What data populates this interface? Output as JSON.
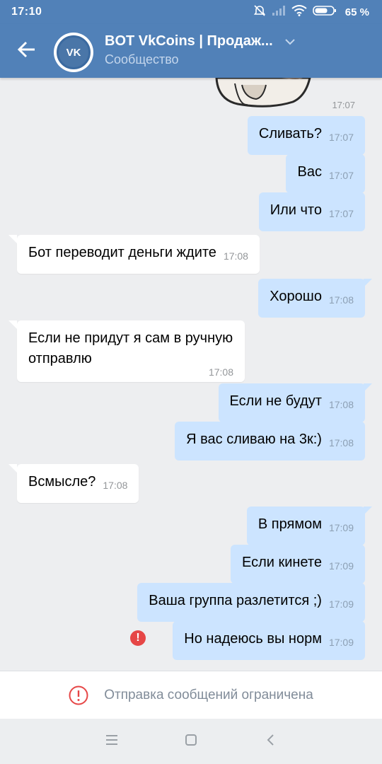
{
  "status": {
    "time": "17:10",
    "battery": "65 %"
  },
  "header": {
    "title": "BOT VkCoins | Продаж...",
    "subtitle": "Сообщество",
    "avatar_text": "VK"
  },
  "sticker": {
    "time": "17:07"
  },
  "messages": [
    {
      "dir": "out",
      "text": "Сливать?",
      "time": "17:07"
    },
    {
      "dir": "out",
      "text": "Вас",
      "time": "17:07"
    },
    {
      "dir": "out",
      "text": "Или что",
      "time": "17:07"
    },
    {
      "dir": "in",
      "text": "Бот переводит деньги ждите",
      "time": "17:08"
    },
    {
      "dir": "out",
      "text": "Хорошо",
      "time": "17:08"
    },
    {
      "dir": "in",
      "text_line1": "Если не придут я сам в ручную",
      "text_line2": "отправлю",
      "time": "17:08"
    },
    {
      "dir": "out",
      "text": "Если не будут",
      "time": "17:08"
    },
    {
      "dir": "out",
      "text": "Я вас сливаю на 3к:)",
      "time": "17:08"
    },
    {
      "dir": "in",
      "text": "Всмысле?",
      "time": "17:08"
    },
    {
      "dir": "out",
      "text": "В прямом",
      "time": "17:09"
    },
    {
      "dir": "out",
      "text": "Если кинете",
      "time": "17:09"
    },
    {
      "dir": "out",
      "text": "Ваша группа разлетится ;)",
      "time": "17:09"
    },
    {
      "dir": "out",
      "text": "Но надеюсь вы норм",
      "time": "17:09",
      "failed": true
    }
  ],
  "restriction": {
    "text": "Отправка сообщений ограничена"
  },
  "icons": {
    "back": "arrow-left-icon",
    "chevron": "chevron-down-icon",
    "error": "exclamation-icon",
    "menu": "menu-icon",
    "home": "square-home-icon",
    "nav_back": "chevron-left-icon"
  },
  "colors": {
    "header": "#5181b8",
    "outgoing_bubble": "#cce4ff",
    "incoming_bubble": "#ffffff",
    "error": "#e64646"
  }
}
